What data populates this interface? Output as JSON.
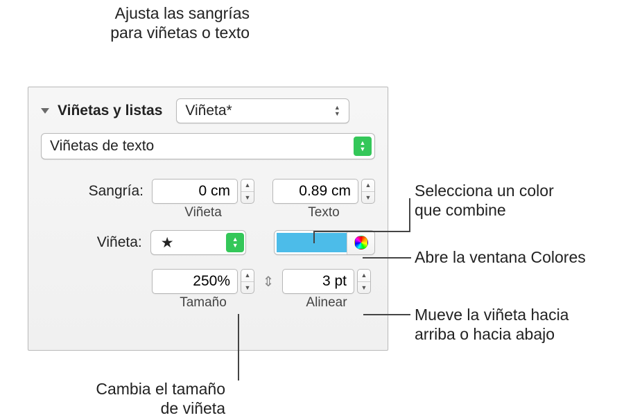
{
  "callouts": {
    "top_l1": "Ajusta las sangrías",
    "top_l2": "para viñetas o texto",
    "color_l1": "Selecciona un color",
    "color_l2": "que combine",
    "picker": "Abre la ventana Colores",
    "align_l1": "Mueve la viñeta hacia",
    "align_l2": "arriba o hacia abajo",
    "size_l1": "Cambia el tamaño",
    "size_l2": "de viñeta"
  },
  "panel": {
    "section_title": "Viñetas y listas",
    "style_select": "Viñeta*",
    "type_select": "Viñetas de texto",
    "sangria_label": "Sangría:",
    "indent_bullet_value": "0 cm",
    "indent_bullet_caption": "Viñeta",
    "indent_text_value": "0.89 cm",
    "indent_text_caption": "Texto",
    "vineta_label": "Viñeta:",
    "bullet_glyph": "★",
    "color_hex": "#4cbce9",
    "size_value": "250%",
    "size_caption": "Tamaño",
    "align_value": "3 pt",
    "align_caption": "Alinear"
  }
}
